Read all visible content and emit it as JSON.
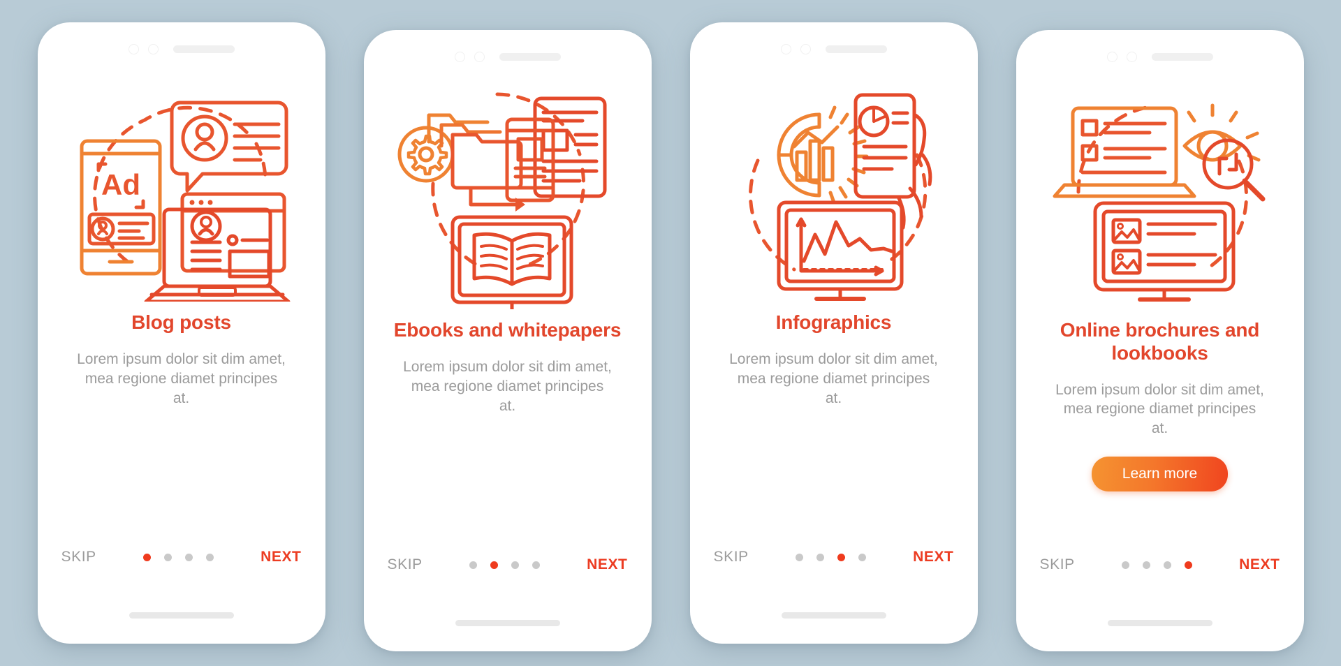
{
  "background_color": "#b8cbd6",
  "accent_color": "#e2462c",
  "muted_color": "#9b9b9b",
  "dot_active_color": "#ef3b1e",
  "button_gradient": [
    "#f59331",
    "#f0451f"
  ],
  "screens": [
    {
      "illustration": "blog-posts-illustration",
      "title": "Blog posts",
      "description": "Lorem ipsum dolor sit dim amet, mea regione diamet principes at.",
      "cta": null,
      "skip_label": "SKIP",
      "next_label": "NEXT",
      "dots": 4,
      "active_dot": 0
    },
    {
      "illustration": "ebooks-whitepapers-illustration",
      "title": "Ebooks and whitepapers",
      "description": "Lorem ipsum dolor sit dim amet, mea regione diamet principes at.",
      "cta": null,
      "skip_label": "SKIP",
      "next_label": "NEXT",
      "dots": 4,
      "active_dot": 1
    },
    {
      "illustration": "infographics-illustration",
      "title": "Infographics",
      "description": "Lorem ipsum dolor sit dim amet, mea regione diamet principes at.",
      "cta": null,
      "skip_label": "SKIP",
      "next_label": "NEXT",
      "dots": 4,
      "active_dot": 2
    },
    {
      "illustration": "online-brochures-illustration",
      "title": "Online brochures and lookbooks",
      "description": "Lorem ipsum dolor sit dim amet, mea regione diamet principes at.",
      "cta": "Learn more",
      "skip_label": "SKIP",
      "next_label": "NEXT",
      "dots": 4,
      "active_dot": 3
    }
  ]
}
